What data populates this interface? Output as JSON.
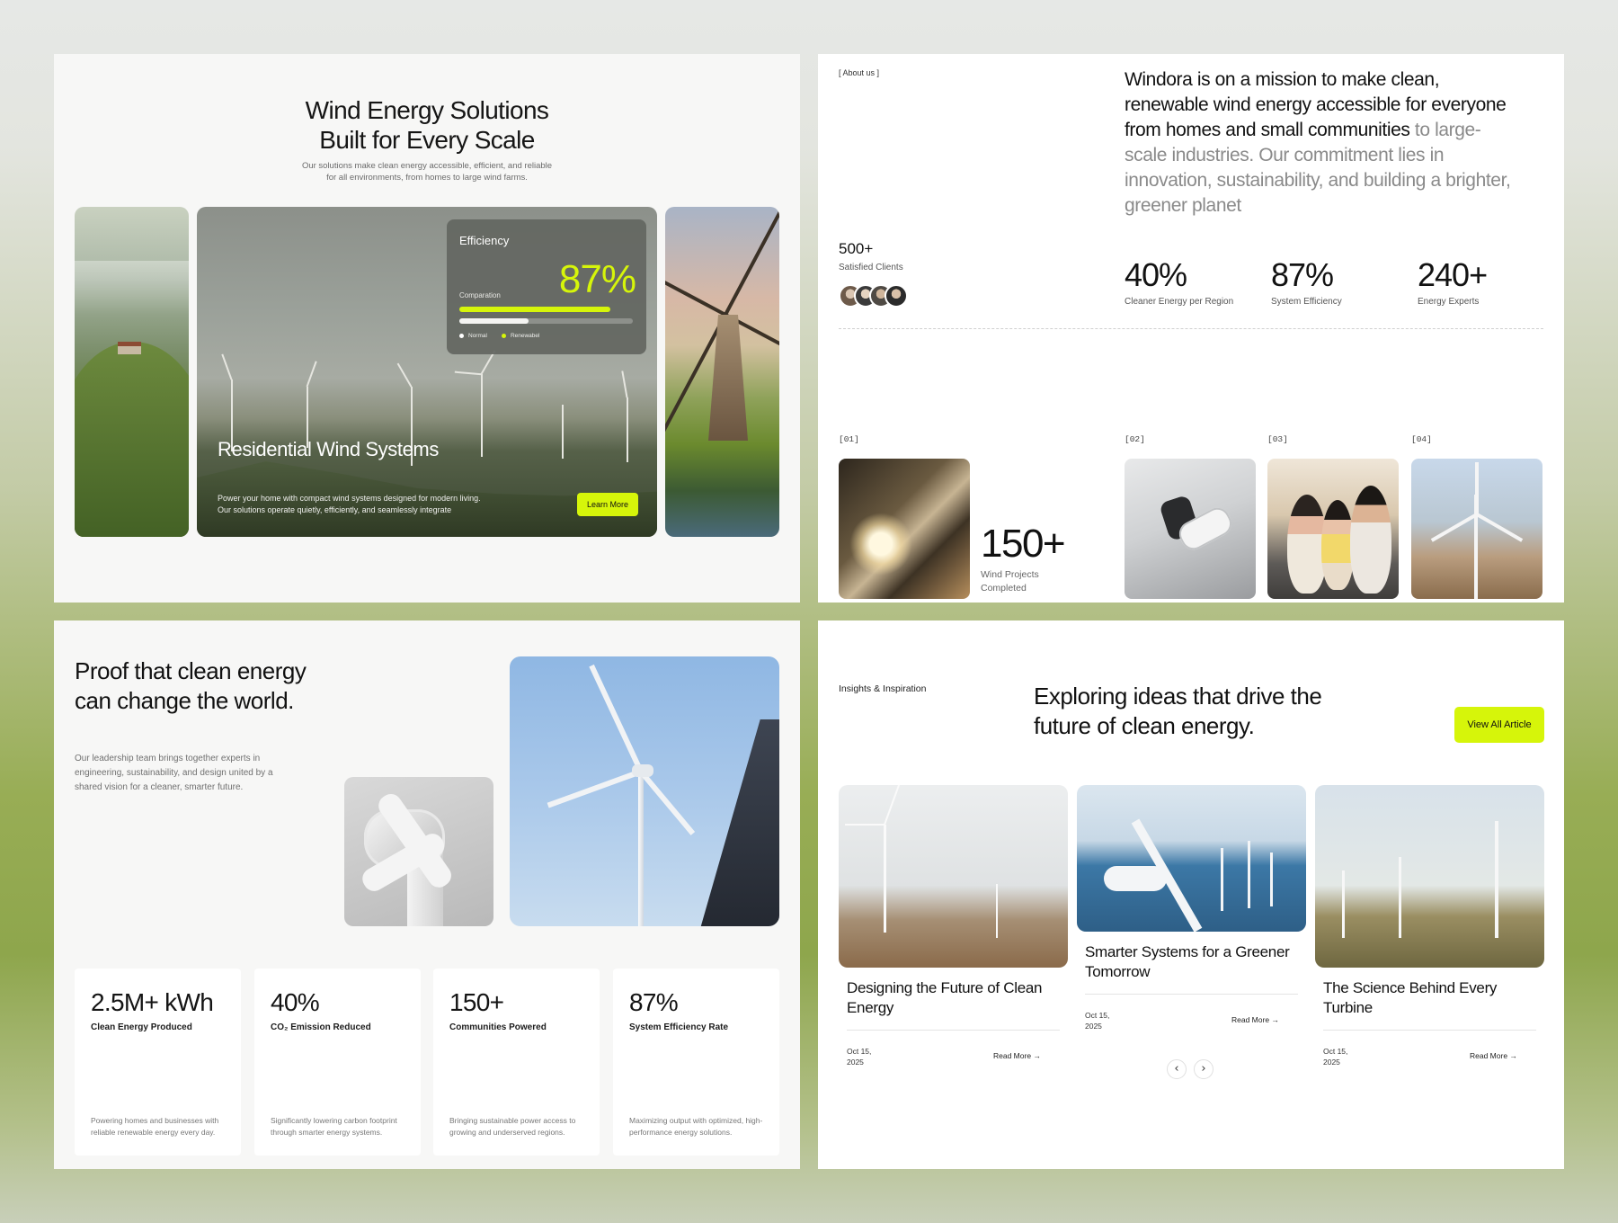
{
  "panel1": {
    "title_line1": "Wind Energy Solutions",
    "title_line2": "Built for Every Scale",
    "subtitle_line1": "Our solutions make clean energy accessible, efficient, and reliable",
    "subtitle_line2": "for all environments, from homes to large wind farms.",
    "efficiency": {
      "title": "Efficiency",
      "comparation_label": "Comparation",
      "value": "87%",
      "renewable_fraction": 0.87,
      "normal_fraction": 0.4,
      "legend_normal": "Normal",
      "legend_renewable": "Renewabel"
    },
    "caption_title": "Residential Wind Systems",
    "caption_line1": "Power your home with compact wind systems designed for modern living.",
    "caption_line2": "Our solutions operate quietly, efficiently, and seamlessly integrate",
    "learn_more": "Learn More"
  },
  "panel2": {
    "tag": "[ About us ]",
    "heading_dark": "Windora is on a mission to make clean, renewable wind energy accessible for everyone from homes and small communities",
    "heading_muted": " to large-scale industries. Our commitment lies in innovation, sustainability, and building a brighter, greener planet",
    "clients_value": "500+",
    "clients_label": "Satisfied Clients",
    "stats": [
      {
        "value": "40%",
        "label": "Cleaner Energy per Region"
      },
      {
        "value": "87%",
        "label": "System Efficiency"
      },
      {
        "value": "240+",
        "label": "Energy Experts"
      }
    ],
    "indices": [
      "[01]",
      "[02]",
      "[03]",
      "[04]"
    ],
    "projects_value": "150+",
    "projects_label": "Wind Projects Completed"
  },
  "panel3": {
    "title": "Proof that clean energy can change the world.",
    "subtitle": "Our leadership team brings together experts in engineering, sustainability, and design united by a shared vision for a cleaner, smarter future.",
    "cards": [
      {
        "value": "2.5M+ kWh",
        "label": "Clean Energy Produced",
        "desc": "Powering homes and businesses with reliable renewable energy every day."
      },
      {
        "value": "40%",
        "label": "CO₂ Emission Reduced",
        "desc": "Significantly lowering carbon footprint through smarter energy systems."
      },
      {
        "value": "150+",
        "label": "Communities Powered",
        "desc": "Bringing sustainable power access to growing and underserved regions."
      },
      {
        "value": "87%",
        "label": "System Efficiency Rate",
        "desc": "Maximizing output with optimized, high-performance energy solutions."
      }
    ]
  },
  "panel4": {
    "tag": "Insights & Inspiration",
    "title": "Exploring ideas that drive the future of clean energy.",
    "view_all": "View All Article",
    "articles": [
      {
        "title": "Designing the Future of Clean Energy",
        "date": "Oct 15, 2025",
        "read": "Read More"
      },
      {
        "title": "Smarter Systems for a Greener Tomorrow",
        "date": "Oct 15, 2025",
        "read": "Read More"
      },
      {
        "title": "The Science Behind Every Turbine",
        "date": "Oct 15, 2025",
        "read": "Read More"
      }
    ],
    "prev_icon": "chevron-left-icon",
    "next_icon": "chevron-right-icon"
  },
  "colors": {
    "accent": "#d6f50a",
    "text": "#111111",
    "muted": "#8a8a8a"
  }
}
